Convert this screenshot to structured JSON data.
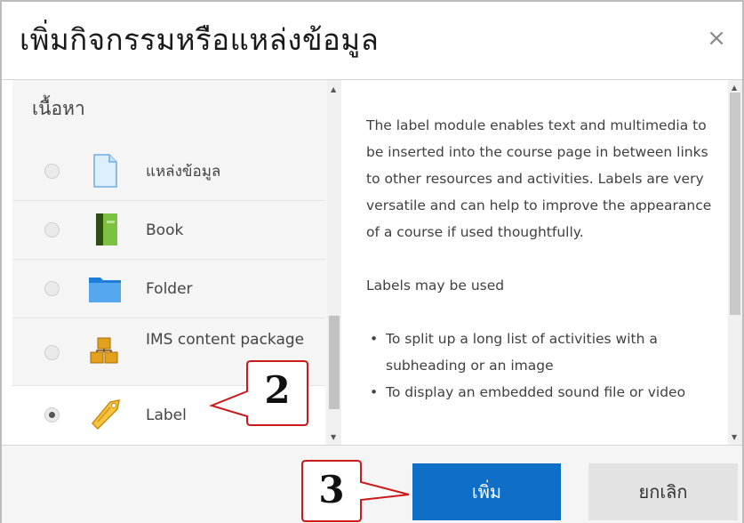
{
  "dialog": {
    "title": "เพิ่มกิจกรรมหรือแหล่งข้อมูล",
    "close_glyph": "×"
  },
  "chooser": {
    "section_title": "เนื้อหา",
    "items": [
      {
        "label": "แหล่งข้อมูล",
        "icon": "file-icon",
        "selected": false
      },
      {
        "label": "Book",
        "icon": "book-icon",
        "selected": false
      },
      {
        "label": "Folder",
        "icon": "folder-icon",
        "selected": false
      },
      {
        "label": "IMS content package",
        "icon": "package-icon",
        "selected": false
      },
      {
        "label": "Label",
        "icon": "label-tag-icon",
        "selected": true
      }
    ]
  },
  "description": {
    "paragraph1": "The label module enables text and multimedia to be inserted into the course page in between links to other resources and activities. Labels are very versatile and can help to improve the appearance of a course if used thoughtfully.",
    "paragraph2": "Labels may be used",
    "bullets": [
      "To split up a long list of activities with a subheading or an image",
      "To display an embedded sound file or video"
    ]
  },
  "footer": {
    "add_label": "เพิ่ม",
    "cancel_label": "ยกเลิก"
  },
  "annotations": {
    "step2": "2",
    "step3": "3"
  },
  "colors": {
    "primary": "#0f6fc6",
    "callout_border": "#cc1a1a",
    "selected_row": "#ffffff",
    "panel_bg": "#f5f5f5"
  }
}
